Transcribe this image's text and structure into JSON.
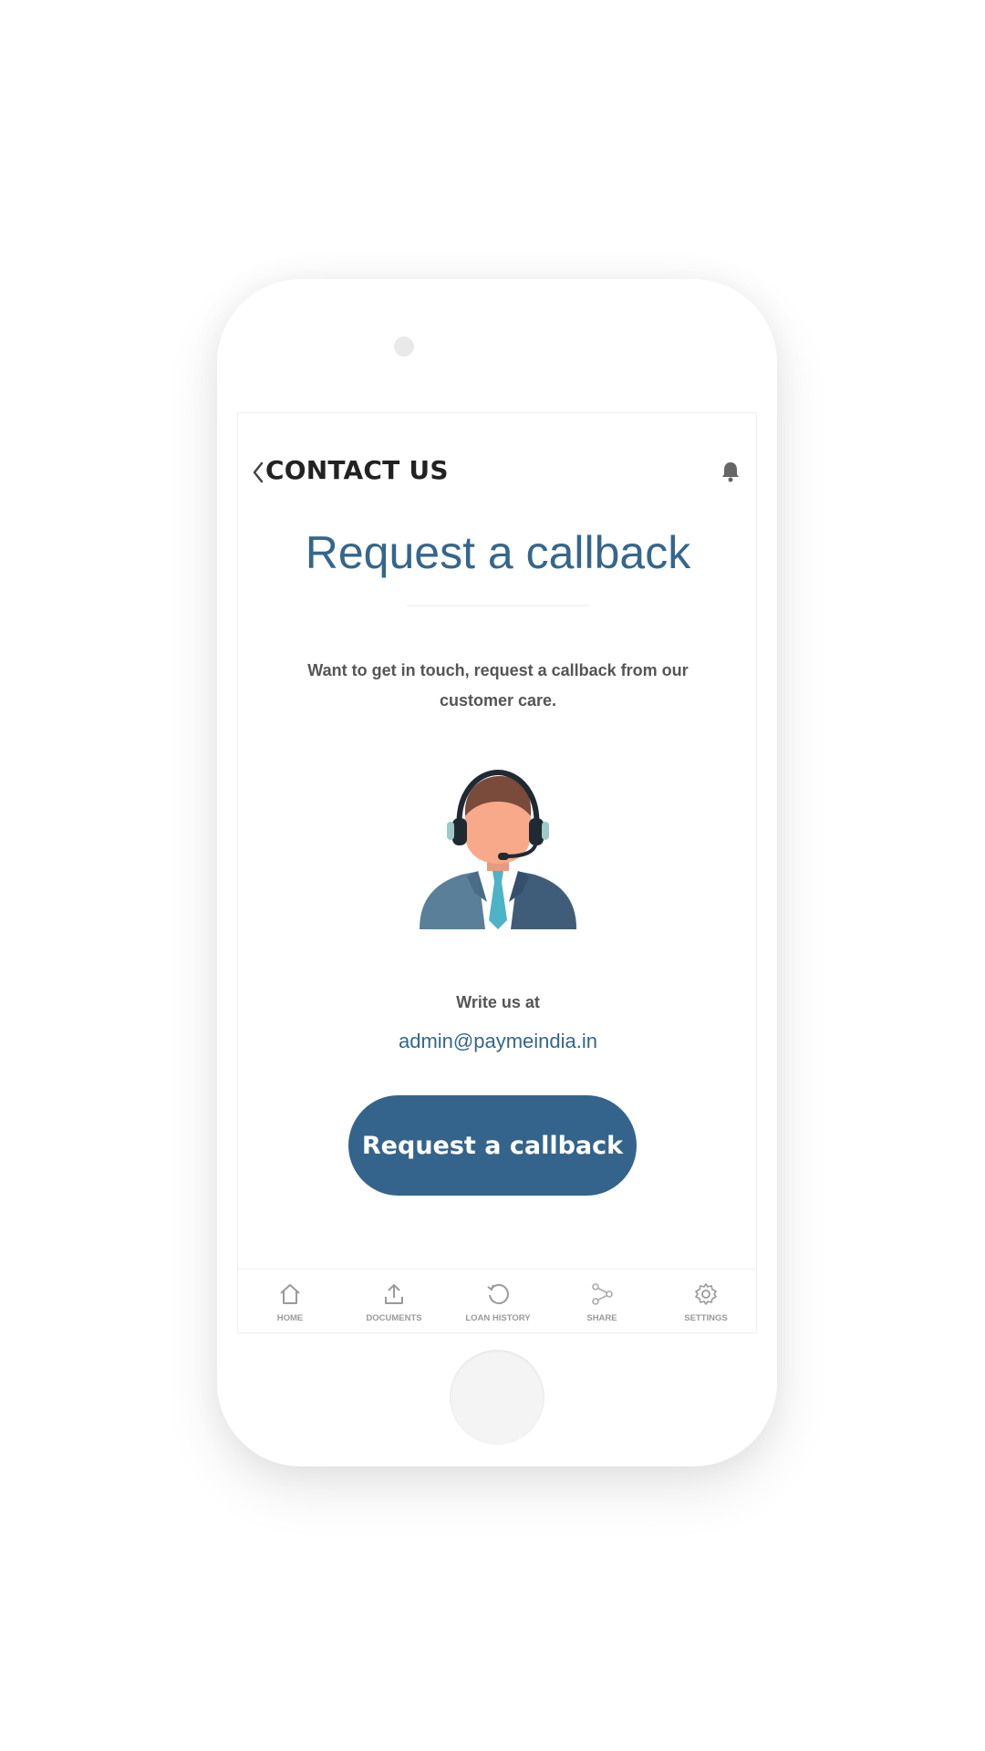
{
  "header": {
    "title": "CONTACT US",
    "back_icon": "chevron-left-icon",
    "notifications_icon": "bell-icon"
  },
  "main": {
    "title": "Request a callback",
    "description": "Want to get in touch, request a callback from our customer care.",
    "illustration": "customer-support-agent",
    "write_label": "Write us at",
    "email": "admin@paymeindia.in",
    "button_label": "Request a callback"
  },
  "nav": {
    "items": [
      {
        "label": "HOME",
        "icon": "home-icon"
      },
      {
        "label": "DOCUMENTS",
        "icon": "upload-icon"
      },
      {
        "label": "LOAN HISTORY",
        "icon": "history-icon"
      },
      {
        "label": "SHARE",
        "icon": "share-icon"
      },
      {
        "label": "SETTINGS",
        "icon": "gear-icon"
      }
    ]
  },
  "colors": {
    "accent": "#34648b",
    "title_text": "#35668d",
    "header_text": "#222222",
    "nav_text": "#9a9a9a"
  }
}
